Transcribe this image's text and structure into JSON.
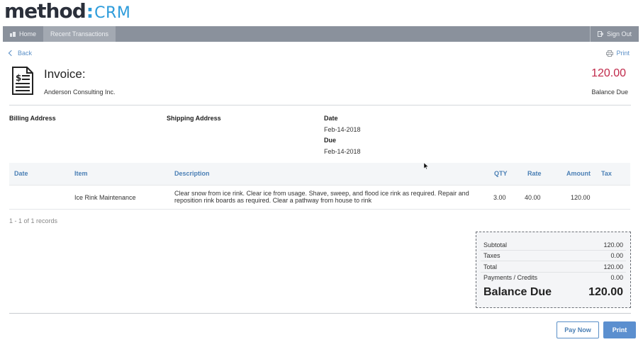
{
  "logo": {
    "word": "method",
    "colon": ":",
    "product": "CRM"
  },
  "nav": {
    "items": [
      {
        "label": "Home",
        "icon": "home-icon"
      },
      {
        "label": "Recent Transactions"
      }
    ],
    "sign_out": {
      "label": "Sign Out",
      "icon": "sign-out-icon"
    }
  },
  "links": {
    "back": "Back",
    "print": "Print"
  },
  "invoice": {
    "title": "Invoice:",
    "customer": "Anderson Consulting Inc.",
    "balance_amount": "120.00",
    "balance_label": "Balance Due",
    "icon": "invoice-document-icon"
  },
  "addresses": {
    "billing_label": "Billing Address",
    "shipping_label": "Shipping Address",
    "date_label": "Date",
    "date_value": "Feb-14-2018",
    "due_label": "Due",
    "due_value": "Feb-14-2018"
  },
  "table": {
    "columns": [
      "Date",
      "Item",
      "Description",
      "QTY",
      "Rate",
      "Amount",
      "Tax"
    ],
    "rows": [
      {
        "date": "",
        "item": "Ice Rink Maintenance",
        "description_line1": "Clear snow from ice rink. Clear ice from usage. Shave, sweep, and flood ice rink as required. Repair and",
        "description_line2": "reposition rink boards as required. Clear a pathway from house to rink",
        "qty": "3.00",
        "rate": "40.00",
        "amount": "120.00",
        "tax": ""
      }
    ],
    "records": "1 - 1 of 1 records"
  },
  "totals": {
    "subtotal_label": "Subtotal",
    "subtotal": "120.00",
    "taxes_label": "Taxes",
    "taxes": "0.00",
    "total_label": "Total",
    "total": "120.00",
    "payments_label": "Payments / Credits",
    "payments": "0.00",
    "balance_label": "Balance Due",
    "balance": "120.00"
  },
  "buttons": {
    "pay_now": "Pay Now",
    "print": "Print"
  },
  "colors": {
    "accent": "#5b8fcf",
    "balance": "#c0294a",
    "nav": "#8a919c"
  }
}
